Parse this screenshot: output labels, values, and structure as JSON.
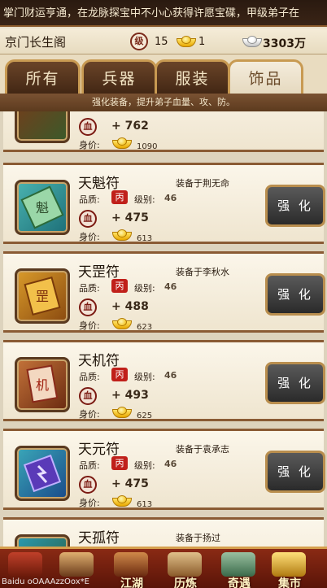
{
  "ticker": {
    "text": "掌门财运亨通，在龙脉探宝中不小心获得许愿宝碟，甲级弟子在"
  },
  "header": {
    "sect_name": "京门长生阁",
    "level_badge": "级",
    "level": "15",
    "gold": "1",
    "silver": "3303万"
  },
  "tabs": [
    {
      "label": "所有",
      "active": false
    },
    {
      "label": "兵器",
      "active": false
    },
    {
      "label": "服装",
      "active": false
    },
    {
      "label": "饰品",
      "active": true
    }
  ],
  "tip": "强化装备，提升弟子血量、攻、防。",
  "labels": {
    "quality": "品质:",
    "level": "级别:",
    "price": "身价:",
    "hp_icon": "血",
    "quality_badge": "丙",
    "upgrade": "强 化"
  },
  "items": [
    {
      "name": "",
      "equip": "",
      "level": "",
      "hp": "+ 762",
      "price": "1090"
    },
    {
      "name": "天魁符",
      "equip": "装备于荆无命",
      "level": "46",
      "hp": "+ 475",
      "price": "613"
    },
    {
      "name": "天罡符",
      "equip": "装备于李秋水",
      "level": "46",
      "hp": "+ 488",
      "price": "623"
    },
    {
      "name": "天机符",
      "equip": "",
      "level": "46",
      "hp": "+ 493",
      "price": "625"
    },
    {
      "name": "天元符",
      "equip": "装备于袁承志",
      "level": "46",
      "hp": "+ 475",
      "price": "613"
    },
    {
      "name": "天孤符",
      "equip": "装备于扬过",
      "level": "",
      "hp": "",
      "price": ""
    }
  ],
  "bottom_nav": [
    "",
    "",
    "江湖",
    "历炼",
    "奇遇",
    "集市"
  ],
  "watermark": "Baidu  oOAAAzzOox*E",
  "colors": {
    "tab_active": "#efe5cf",
    "tab_inactive": "#4e301a",
    "quality_red": "#c0201a",
    "nav_bg": "#7a2010"
  }
}
